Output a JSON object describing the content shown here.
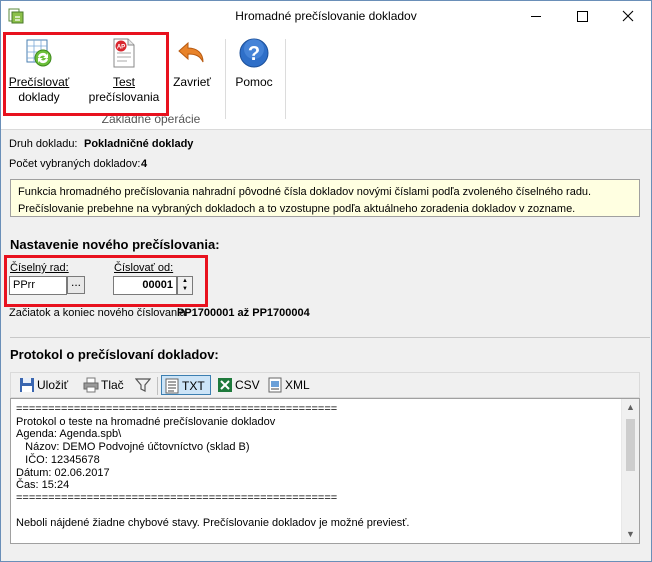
{
  "window": {
    "title": "Hromadné prečíslovanie dokladov"
  },
  "ribbon": {
    "renumber_line1": "Prečíslovať",
    "renumber_line2": "doklady",
    "test_line1": "Test",
    "test_line2": "prečíslovania",
    "close_label": "Zavrieť",
    "help_label": "Pomoc",
    "group_label": "Základné operácie"
  },
  "info": {
    "doc_type_label": "Druh dokladu:",
    "doc_type_value": "Pokladničné doklady",
    "count_label": "Počet vybraných dokladov:",
    "count_value": "4",
    "notice": "Funkcia hromadného prečíslovania nahradní pôvodné čísla dokladov novými číslami podľa zvoleného číselného radu. Prečíslovanie prebehne na vybraných dokladoch a to vzostupne podľa aktuálneho zoradenia dokladov v zozname."
  },
  "settings": {
    "title": "Nastavenie nového prečíslovania:",
    "series_label": "Číselný rad:",
    "series_value": "PPrr",
    "ellipsis": "...",
    "start_label": "Číslovať od:",
    "start_value": "00001",
    "range_label": "Začiatok a koniec nového číslovania",
    "range_value": "PP1700001 až PP1700004"
  },
  "protocol": {
    "title": "Protokol o prečíslovaní dokladov:",
    "toolbar": {
      "save": "Uložiť",
      "print": "Tlač",
      "txt": "TXT",
      "csv": "CSV",
      "xml": "XML"
    },
    "lines": [
      "==================================================",
      "Protokol o teste na hromadné prečíslovanie dokladov",
      "Agenda: Agenda.spb\\",
      "   Názov: DEMO Podvojné účtovníctvo (sklad B)",
      "   IČO: 12345678",
      "Dátum: 02.06.2017",
      "Čas: 15:24",
      "==================================================",
      "",
      "Neboli nájdené žiadne chybové stavy. Prečíslovanie dokladov je možné previesť."
    ]
  }
}
